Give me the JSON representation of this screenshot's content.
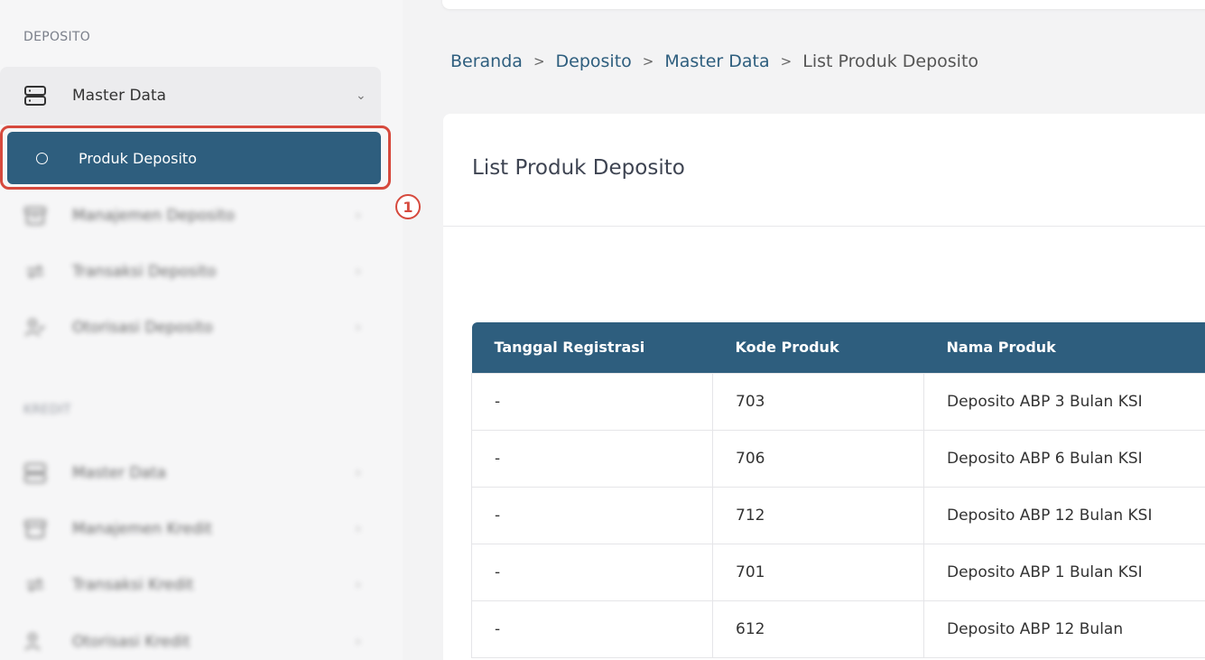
{
  "sidebar": {
    "section_deposito": "DEPOSITO",
    "master_data": "Master Data",
    "produk_deposito": "Produk Deposito",
    "manajemen_deposito": "Manajemen Deposito",
    "transaksi_deposito": "Transaksi Deposito",
    "otorisasi_deposito": "Otorisasi Deposito",
    "section_kredit": "KREDIT",
    "master_data_kredit": "Master Data",
    "manajemen_kredit": "Manajemen Kredit",
    "transaksi_kredit": "Transaksi Kredit",
    "otorisasi_kredit": "Otorisasi Kredit"
  },
  "step_badge": "1",
  "breadcrumb": {
    "home": "Beranda",
    "deposito": "Deposito",
    "master": "Master Data",
    "current": "List Produk Deposito",
    "sep": ">"
  },
  "card": {
    "title": "List Produk Deposito"
  },
  "table": {
    "headers": [
      "Tanggal Registrasi",
      "Kode Produk",
      "Nama Produk"
    ],
    "rows": [
      [
        "-",
        "703",
        "Deposito ABP 3 Bulan KSI"
      ],
      [
        "-",
        "706",
        "Deposito ABP 6 Bulan KSI"
      ],
      [
        "-",
        "712",
        "Deposito ABP 12 Bulan KSI"
      ],
      [
        "-",
        "701",
        "Deposito ABP 1 Bulan KSI"
      ],
      [
        "-",
        "612",
        "Deposito ABP 12 Bulan"
      ]
    ]
  },
  "colors": {
    "primary": "#2e5e7e",
    "highlight": "#d6493d"
  }
}
